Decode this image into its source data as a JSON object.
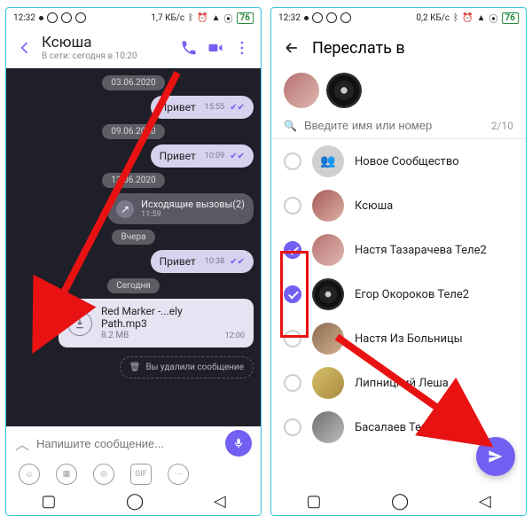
{
  "status_left": {
    "time": "12:32",
    "data_rate": "1,7 КБ/с",
    "battery": "76"
  },
  "status_right": {
    "time": "12:32",
    "data_rate": "0,2 КБ/с",
    "battery": "76"
  },
  "chat": {
    "title": "Ксюша",
    "subtitle": "В сети: сегодня в 10:20",
    "dates": {
      "d1": "03.06.2020",
      "d2": "09.06.2020",
      "d3": "12.06.2020",
      "d4": "Вчера",
      "d5": "Сегодня"
    },
    "m1": {
      "text": "Привет",
      "time": "15:55"
    },
    "m2": {
      "text": "Привет",
      "time": "10:09"
    },
    "call": {
      "label": "Исходящие вызовы(2)",
      "time": "11:59"
    },
    "m3": {
      "text": "Привет",
      "time": "10:38"
    },
    "file": {
      "name": "Red Marker -...ely Path.mp3",
      "size": "8.2 MB",
      "time": "12:00"
    },
    "deleted": "Вы удалили сообщение",
    "composer_placeholder": "Напишите сообщение...",
    "gif_label": "GIF"
  },
  "forward": {
    "title": "Переслать в",
    "input_placeholder": "Введите имя или номер",
    "counter": "2/10",
    "contacts": [
      {
        "name": "Новое Сообщество",
        "selected": false,
        "kind": "group"
      },
      {
        "name": "Ксюша",
        "selected": false,
        "kind": "p1"
      },
      {
        "name": "Настя Тазарачева Теле2",
        "selected": true,
        "kind": "p2"
      },
      {
        "name": "Егор Окороков Теле2",
        "selected": true,
        "kind": "wheel"
      },
      {
        "name": "Настя Из Больницы",
        "selected": false,
        "kind": "p4"
      },
      {
        "name": "Липницкий Леша",
        "selected": false,
        "kind": "p5"
      },
      {
        "name": "Басалаев Тема",
        "selected": false,
        "kind": "p6"
      }
    ]
  }
}
